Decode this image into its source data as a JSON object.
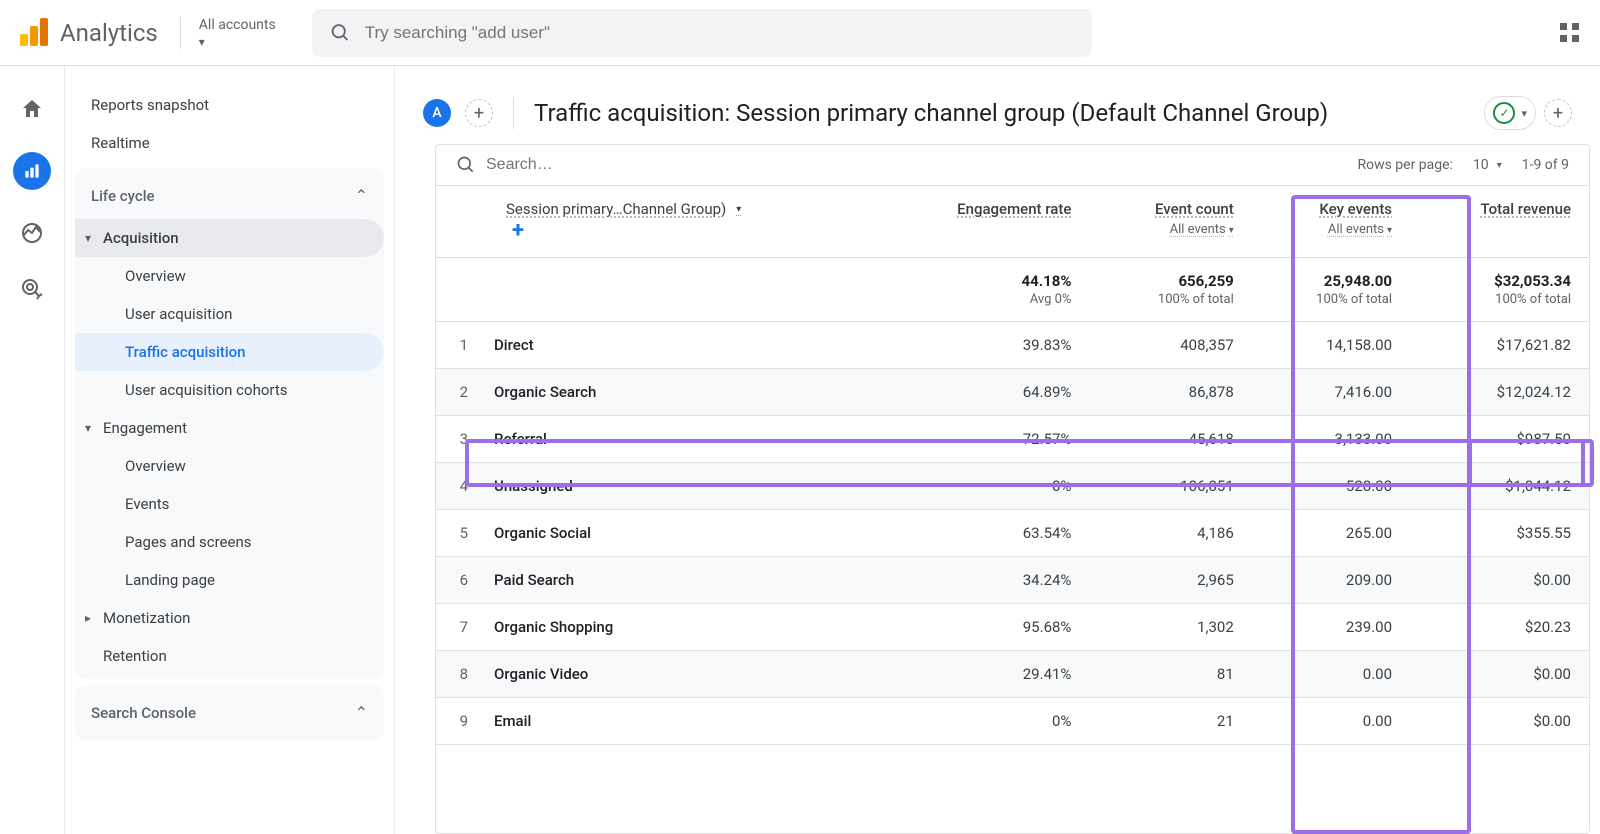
{
  "header": {
    "product": "Analytics",
    "account_label": "All accounts",
    "search_placeholder": "Try searching \"add user\""
  },
  "sidebar": {
    "reports_snapshot": "Reports snapshot",
    "realtime": "Realtime",
    "life_cycle": "Life cycle",
    "acquisition": {
      "label": "Acquisition",
      "overview": "Overview",
      "user_acq": "User acquisition",
      "traffic_acq": "Traffic acquisition",
      "user_acq_cohorts": "User acquisition cohorts"
    },
    "engagement": {
      "label": "Engagement",
      "overview": "Overview",
      "events": "Events",
      "pages_screens": "Pages and screens",
      "landing_page": "Landing page"
    },
    "monetization": "Monetization",
    "retention": "Retention",
    "search_console": "Search Console"
  },
  "page": {
    "badge": "A",
    "title": "Traffic acquisition: Session primary channel group (Default Channel Group)"
  },
  "table": {
    "search_placeholder": "Search…",
    "rows_per_page_label": "Rows per page:",
    "rows_per_page_value": "10",
    "range": "1-9 of 9",
    "dim_header": "Session primary…Channel Group)",
    "columns": {
      "engagement": {
        "label": "Engagement rate",
        "sub": ""
      },
      "event_count": {
        "label": "Event count",
        "sub": "All events"
      },
      "key_events": {
        "label": "Key events",
        "sub": "All events"
      },
      "total_revenue": {
        "label": "Total revenue",
        "sub": ""
      }
    },
    "summary": {
      "engagement": "44.18%",
      "engagement_sub": "Avg 0%",
      "event_count": "656,259",
      "event_count_sub": "100% of total",
      "key_events": "25,948.00",
      "key_events_sub": "100% of total",
      "total_revenue": "$32,053.34",
      "total_revenue_sub": "100% of total"
    },
    "rows": [
      {
        "idx": "1",
        "name": "Direct",
        "engagement": "39.83%",
        "event_count": "408,357",
        "key_events": "14,158.00",
        "total_revenue": "$17,621.82"
      },
      {
        "idx": "2",
        "name": "Organic Search",
        "engagement": "64.89%",
        "event_count": "86,878",
        "key_events": "7,416.00",
        "total_revenue": "$12,024.12"
      },
      {
        "idx": "3",
        "name": "Referral",
        "engagement": "72.57%",
        "event_count": "45,618",
        "key_events": "3,133.00",
        "total_revenue": "$987.50"
      },
      {
        "idx": "4",
        "name": "Unassigned",
        "engagement": "0%",
        "event_count": "106,851",
        "key_events": "528.00",
        "total_revenue": "$1,044.12"
      },
      {
        "idx": "5",
        "name": "Organic Social",
        "engagement": "63.54%",
        "event_count": "4,186",
        "key_events": "265.00",
        "total_revenue": "$355.55"
      },
      {
        "idx": "6",
        "name": "Paid Search",
        "engagement": "34.24%",
        "event_count": "2,965",
        "key_events": "209.00",
        "total_revenue": "$0.00"
      },
      {
        "idx": "7",
        "name": "Organic Shopping",
        "engagement": "95.68%",
        "event_count": "1,302",
        "key_events": "239.00",
        "total_revenue": "$20.23"
      },
      {
        "idx": "8",
        "name": "Organic Video",
        "engagement": "29.41%",
        "event_count": "81",
        "key_events": "0.00",
        "total_revenue": "$0.00"
      },
      {
        "idx": "9",
        "name": "Email",
        "engagement": "0%",
        "event_count": "21",
        "key_events": "0.00",
        "total_revenue": "$0.00"
      }
    ]
  }
}
